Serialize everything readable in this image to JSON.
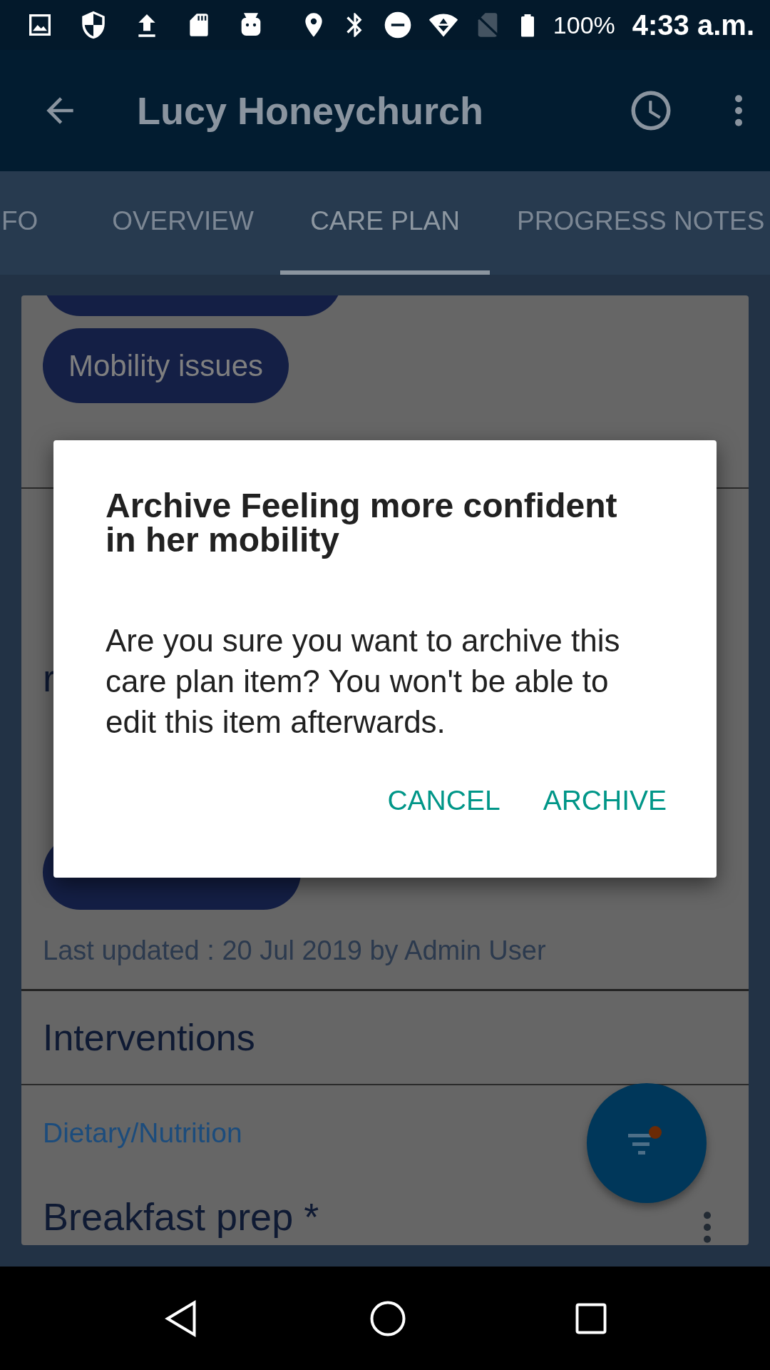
{
  "status_bar": {
    "battery": "100%",
    "time": "4:33 a.m."
  },
  "app_bar": {
    "title": "Lucy Honeychurch"
  },
  "tabs": [
    {
      "label": "FO",
      "selected": false
    },
    {
      "label": "OVERVIEW",
      "selected": false
    },
    {
      "label": "CARE PLAN",
      "selected": true
    },
    {
      "label": "PROGRESS NOTES",
      "selected": false
    }
  ],
  "care_plan": {
    "chip": "Mobility issues",
    "goal_title_fragment": "r",
    "last_updated": "Last updated : 20 Jul 2019 by Admin User",
    "section_title": "Interventions",
    "item_category": "Dietary/Nutrition",
    "item_title": "Breakfast prep *"
  },
  "dialog": {
    "title": "Archive Feeling more confident in her mobility",
    "message": "Are you sure you want to archive this care plan item? You won't be able to edit this item afterwards.",
    "buttons": [
      "CANCEL",
      "ARCHIVE"
    ]
  }
}
